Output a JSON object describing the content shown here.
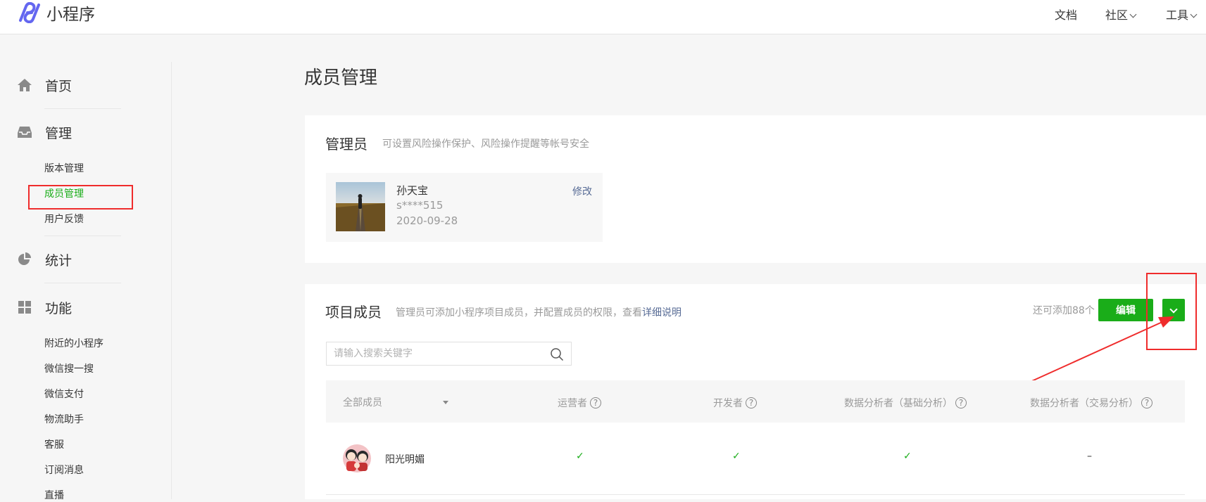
{
  "header": {
    "brand": "小程序",
    "nav": [
      {
        "label": "文档",
        "has_dropdown": false
      },
      {
        "label": "社区",
        "has_dropdown": true
      },
      {
        "label": "工具",
        "has_dropdown": true
      }
    ]
  },
  "sidebar": {
    "categories": [
      {
        "label": "首页",
        "icon": "home-icon"
      },
      {
        "label": "管理",
        "icon": "inbox-icon",
        "items": [
          "版本管理",
          "成员管理",
          "用户反馈"
        ],
        "active": "成员管理"
      },
      {
        "label": "统计",
        "icon": "pie-chart-icon"
      },
      {
        "label": "功能",
        "icon": "grid-icon",
        "items": [
          "附近的小程序",
          "微信搜一搜",
          "微信支付",
          "物流助手",
          "客服",
          "订阅消息",
          "直播"
        ]
      }
    ]
  },
  "page": {
    "title": "成员管理"
  },
  "admin": {
    "title": "管理员",
    "desc": "可设置风险操作保护、风险操作提醒等帐号安全",
    "name": "孙天宝",
    "id": "s****515",
    "date": "2020-09-28",
    "edit": "修改"
  },
  "members": {
    "title": "项目成员",
    "desc": "管理员可添加小程序项目成员，并配置成员的权限，查看",
    "desc_link": "详细说明",
    "quota": "还可添加88个",
    "edit_button": "编辑",
    "search_placeholder": "请输入搜索关键字",
    "columns": [
      "全部成员",
      "运营者",
      "开发者",
      "数据分析者（基础分析）",
      "数据分析者（交易分析）"
    ],
    "rows": [
      {
        "name": "阳光明媚",
        "cells": [
          "✓",
          "✓",
          "✓",
          "–"
        ]
      }
    ]
  },
  "colors": {
    "accent": "#1aad19",
    "link": "#576b95",
    "annotation": "#ef2c2c"
  }
}
